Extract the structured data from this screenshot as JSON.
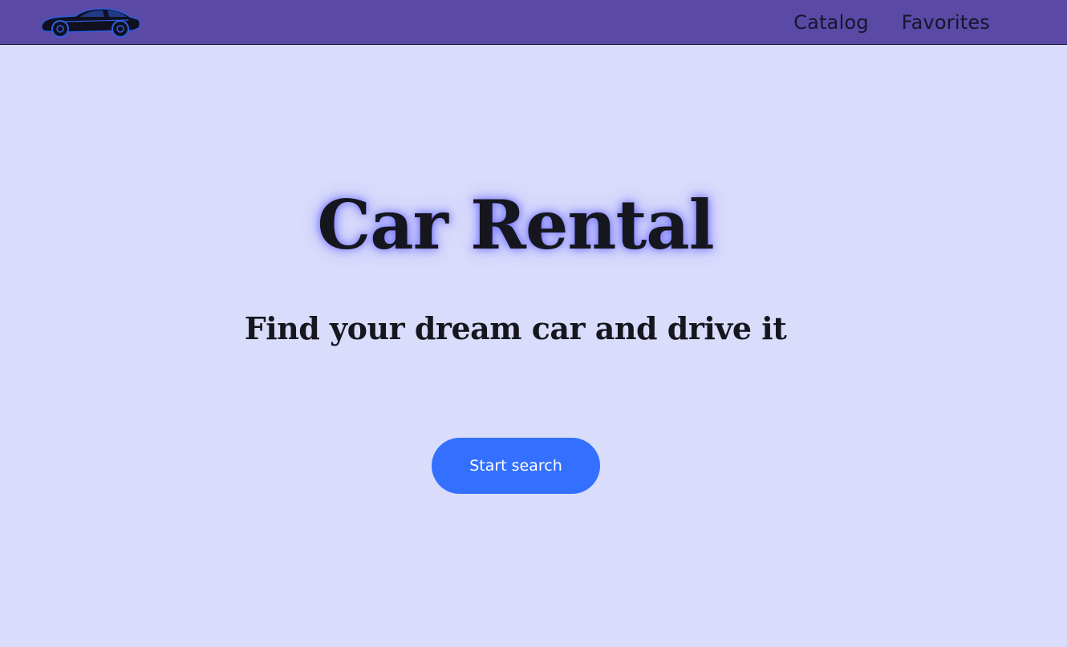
{
  "header": {
    "logo_icon": "sports-car-icon",
    "nav": [
      {
        "label": "Catalog"
      },
      {
        "label": "Favorites"
      }
    ]
  },
  "hero": {
    "title": "Car Rental",
    "subtitle": "Find your dream car and drive it",
    "cta_label": "Start search"
  },
  "colors": {
    "background": "#dadcfb",
    "header": "#5b49a6",
    "accent": "#3470ff",
    "text": "#16161f",
    "logo_accent": "#2f5fe0"
  }
}
